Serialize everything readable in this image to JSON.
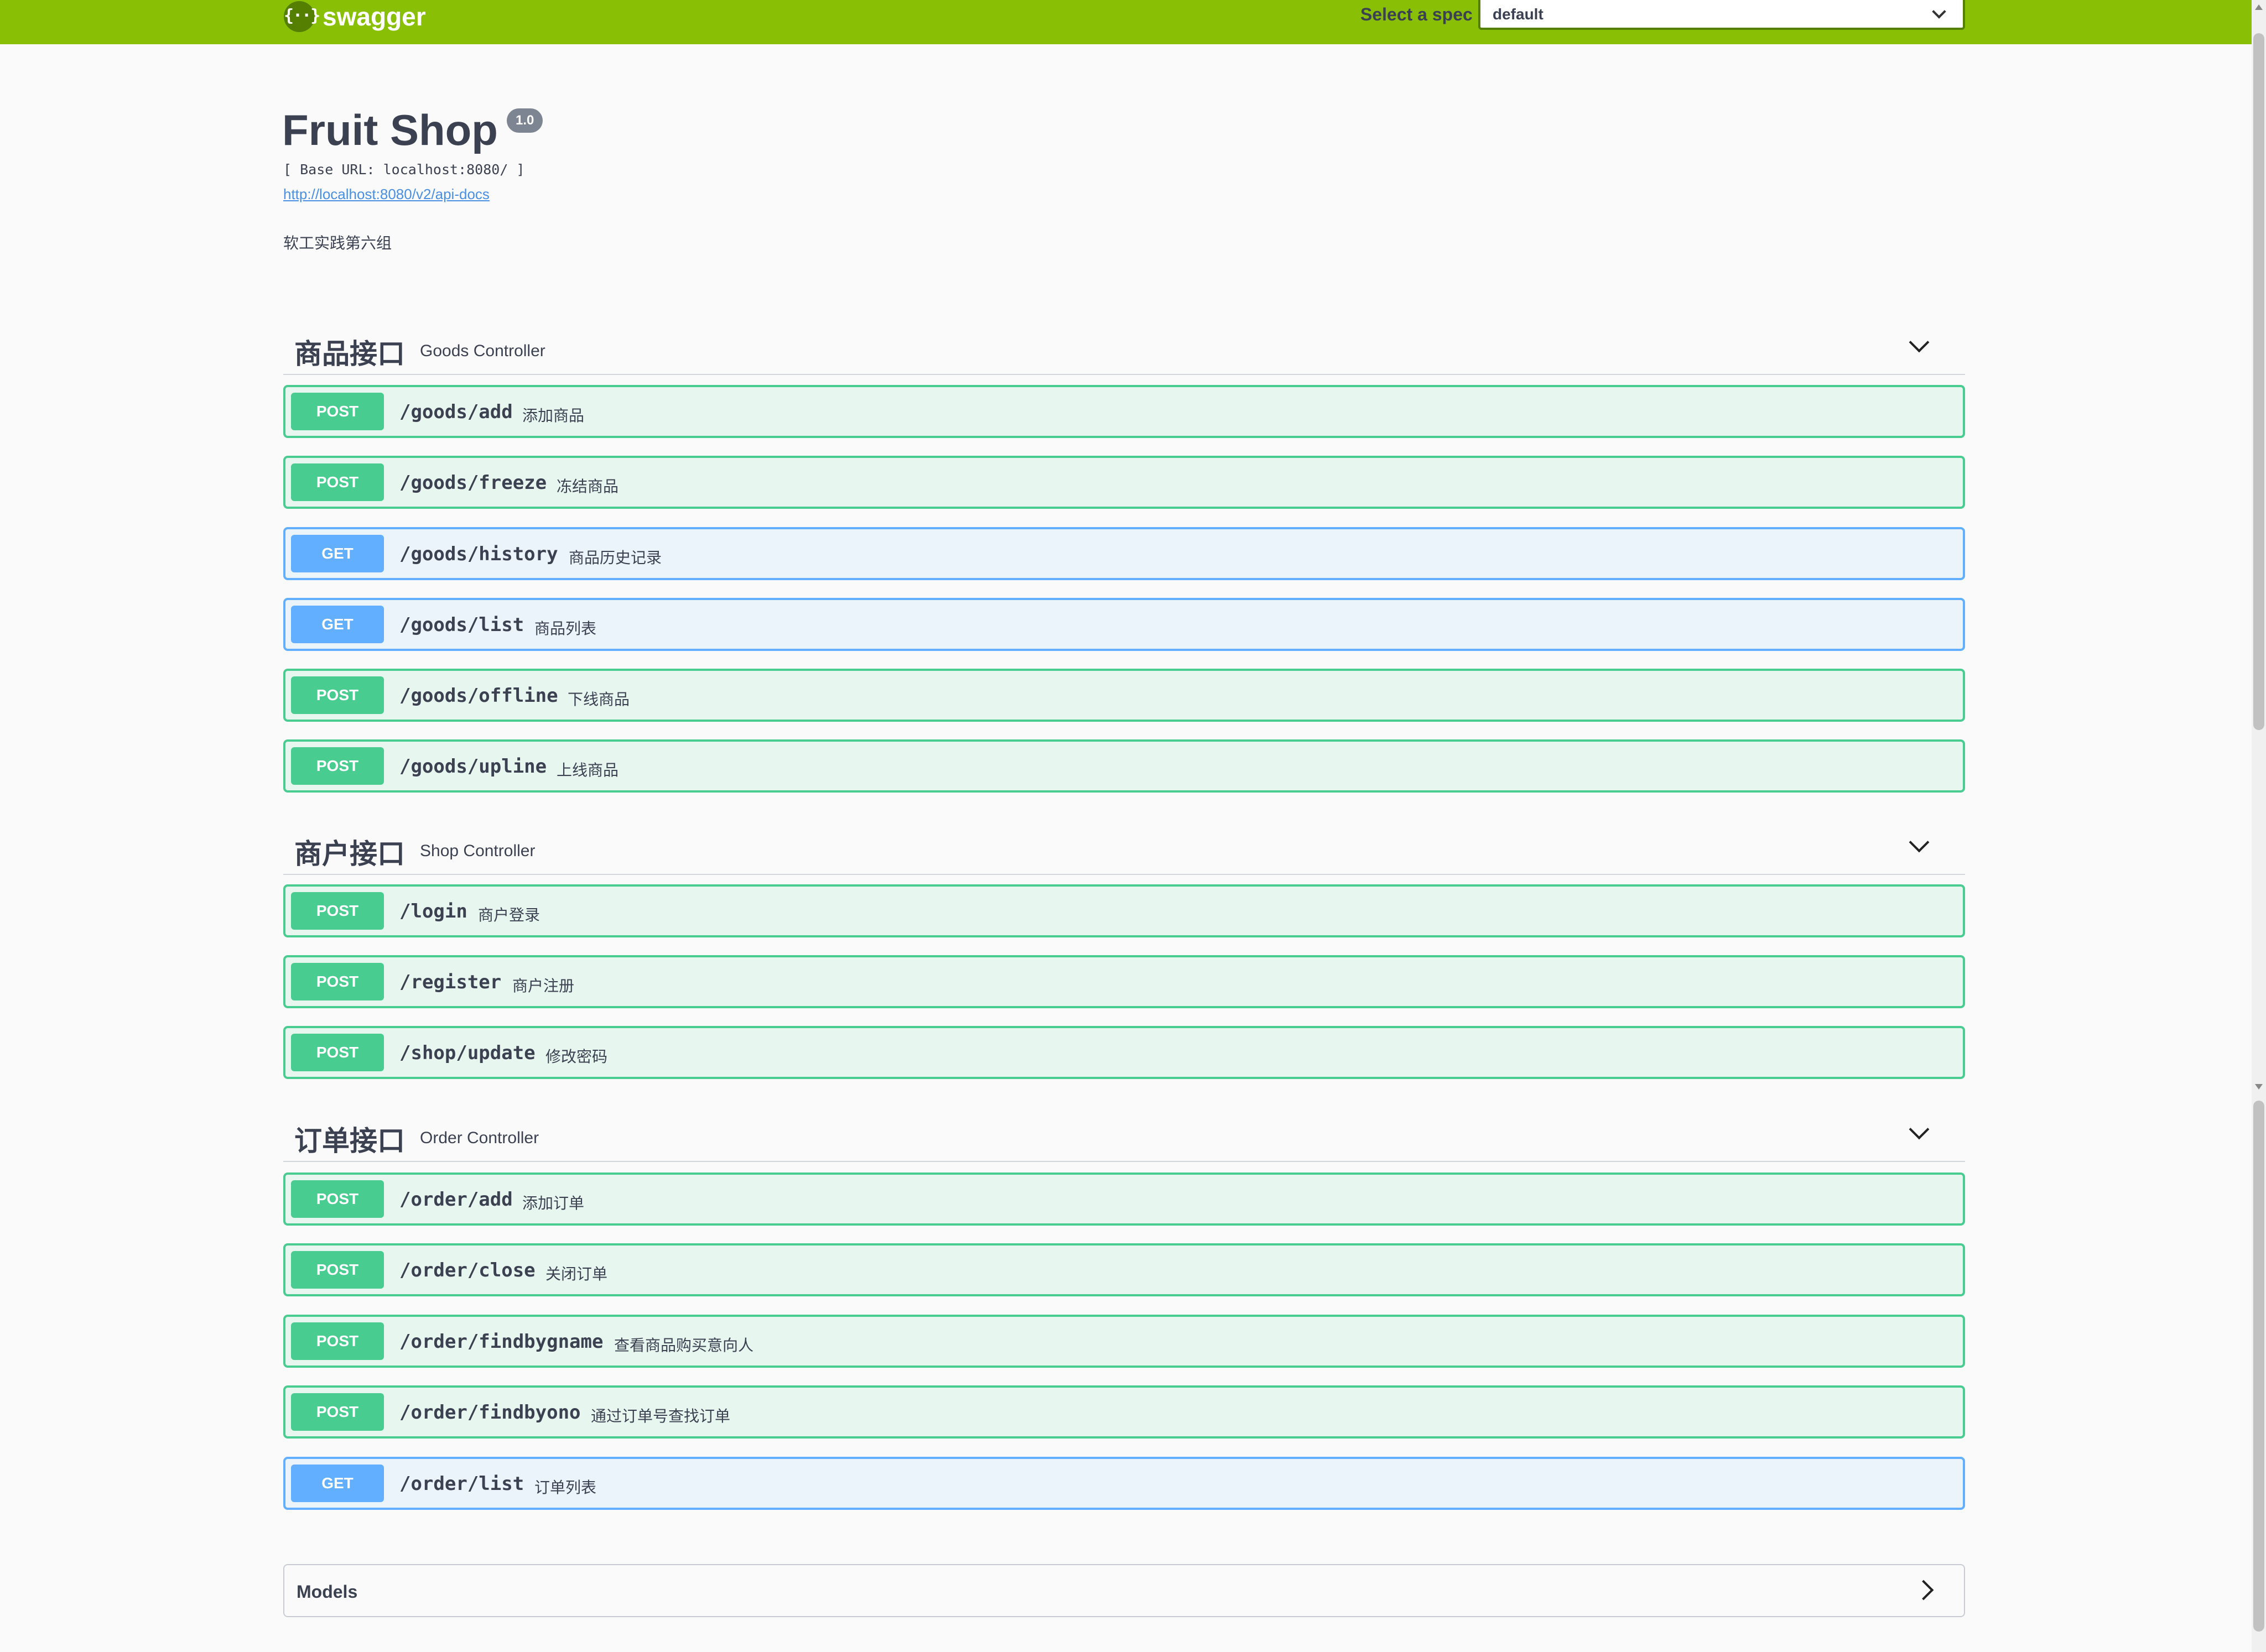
{
  "topbar": {
    "logo_glyph": "{··}",
    "logo_text": "swagger",
    "spec_label": "Select a spec",
    "spec_value": "default",
    "brand_color": "#89bf04"
  },
  "info": {
    "title": "Fruit Shop",
    "version": "1.0",
    "base_url": "[ Base URL: localhost:8080/ ]",
    "api_docs_link": "http://localhost:8080/v2/api-docs",
    "description": "软工实践第六组"
  },
  "tags": [
    {
      "name": "商品接口",
      "description": "Goods Controller",
      "operations": [
        {
          "method": "POST",
          "path": "/goods/add",
          "summary": "添加商品"
        },
        {
          "method": "POST",
          "path": "/goods/freeze",
          "summary": "冻结商品"
        },
        {
          "method": "GET",
          "path": "/goods/history",
          "summary": "商品历史记录"
        },
        {
          "method": "GET",
          "path": "/goods/list",
          "summary": "商品列表"
        },
        {
          "method": "POST",
          "path": "/goods/offline",
          "summary": "下线商品"
        },
        {
          "method": "POST",
          "path": "/goods/upline",
          "summary": "上线商品"
        }
      ]
    },
    {
      "name": "商户接口",
      "description": "Shop Controller",
      "operations": [
        {
          "method": "POST",
          "path": "/login",
          "summary": "商户登录"
        },
        {
          "method": "POST",
          "path": "/register",
          "summary": "商户注册"
        },
        {
          "method": "POST",
          "path": "/shop/update",
          "summary": "修改密码"
        }
      ]
    },
    {
      "name": "订单接口",
      "description": "Order Controller",
      "operations": [
        {
          "method": "POST",
          "path": "/order/add",
          "summary": "添加订单"
        },
        {
          "method": "POST",
          "path": "/order/close",
          "summary": "关闭订单"
        },
        {
          "method": "POST",
          "path": "/order/findbygname",
          "summary": "查看商品购买意向人"
        },
        {
          "method": "POST",
          "path": "/order/findbyono",
          "summary": "通过订单号查找订单"
        },
        {
          "method": "GET",
          "path": "/order/list",
          "summary": "订单列表"
        }
      ]
    }
  ],
  "models": {
    "title": "Models"
  },
  "colors": {
    "post": "#49cc90",
    "get": "#61affe"
  }
}
